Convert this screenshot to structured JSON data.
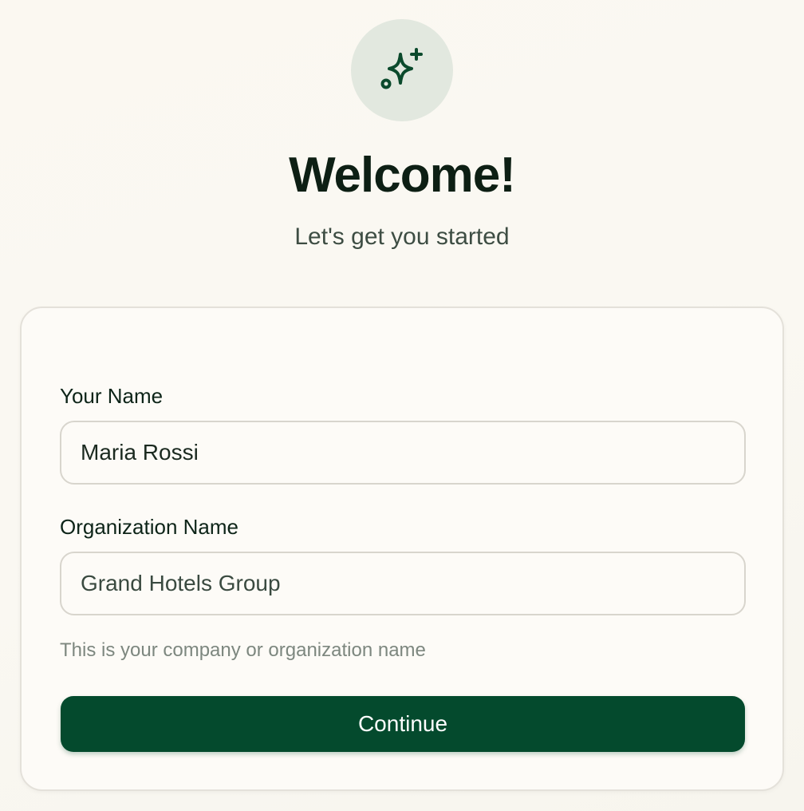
{
  "header": {
    "icon": "sparkles-icon",
    "title": "Welcome!",
    "subtitle": "Let's get you started"
  },
  "form": {
    "name_label": "Your Name",
    "name_value": "Maria Rossi",
    "org_label": "Organization Name",
    "org_value": "Grand Hotels Group",
    "org_helper": "This is your company or organization name",
    "continue_label": "Continue"
  },
  "colors": {
    "accent": "#044a2d",
    "badge_bg": "#e2e8df",
    "background": "#faf8f2"
  }
}
